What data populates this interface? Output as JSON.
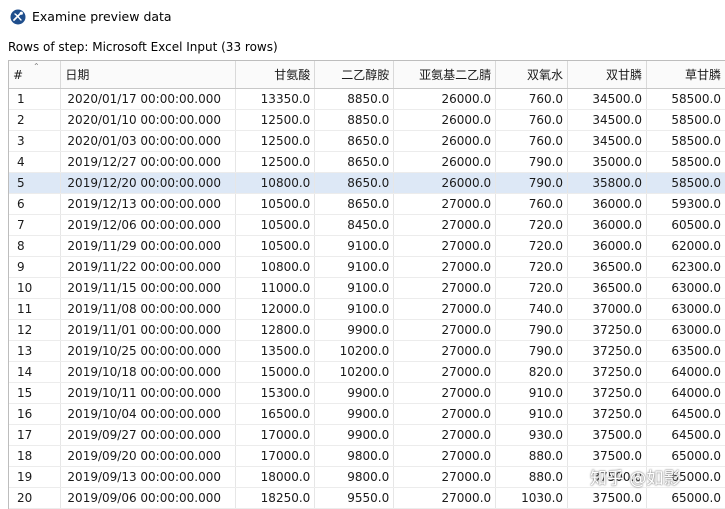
{
  "window": {
    "title": "Examine preview data",
    "icon": "kettle-spoon-icon"
  },
  "subtitle": "Rows of step: Microsoft Excel Input (33 rows)",
  "table": {
    "columns": [
      "#",
      "日期",
      "甘氨酸",
      "二乙醇胺",
      "亚氨基二乙腈",
      "双氧水",
      "双甘膦",
      "草甘膦"
    ],
    "selected_row_index": 4,
    "rows": [
      [
        "1",
        "2020/01/17 00:00:00.000",
        "13350.0",
        "8850.0",
        "26000.0",
        "760.0",
        "34500.0",
        "58500.0"
      ],
      [
        "2",
        "2020/01/10 00:00:00.000",
        "12500.0",
        "8850.0",
        "26000.0",
        "760.0",
        "34500.0",
        "58500.0"
      ],
      [
        "3",
        "2020/01/03 00:00:00.000",
        "12500.0",
        "8650.0",
        "26000.0",
        "760.0",
        "34500.0",
        "58500.0"
      ],
      [
        "4",
        "2019/12/27 00:00:00.000",
        "12500.0",
        "8650.0",
        "26000.0",
        "790.0",
        "35000.0",
        "58500.0"
      ],
      [
        "5",
        "2019/12/20 00:00:00.000",
        "10800.0",
        "8650.0",
        "26000.0",
        "790.0",
        "35800.0",
        "58500.0"
      ],
      [
        "6",
        "2019/12/13 00:00:00.000",
        "10500.0",
        "8650.0",
        "27000.0",
        "760.0",
        "36000.0",
        "59300.0"
      ],
      [
        "7",
        "2019/12/06 00:00:00.000",
        "10500.0",
        "8450.0",
        "27000.0",
        "720.0",
        "36000.0",
        "60500.0"
      ],
      [
        "8",
        "2019/11/29 00:00:00.000",
        "10500.0",
        "9100.0",
        "27000.0",
        "720.0",
        "36000.0",
        "62000.0"
      ],
      [
        "9",
        "2019/11/22 00:00:00.000",
        "10800.0",
        "9100.0",
        "27000.0",
        "720.0",
        "36500.0",
        "62300.0"
      ],
      [
        "10",
        "2019/11/15 00:00:00.000",
        "11000.0",
        "9100.0",
        "27000.0",
        "720.0",
        "36500.0",
        "63000.0"
      ],
      [
        "11",
        "2019/11/08 00:00:00.000",
        "12000.0",
        "9100.0",
        "27000.0",
        "740.0",
        "37000.0",
        "63000.0"
      ],
      [
        "12",
        "2019/11/01 00:00:00.000",
        "12800.0",
        "9900.0",
        "27000.0",
        "790.0",
        "37250.0",
        "63000.0"
      ],
      [
        "13",
        "2019/10/25 00:00:00.000",
        "13500.0",
        "10200.0",
        "27000.0",
        "790.0",
        "37250.0",
        "63500.0"
      ],
      [
        "14",
        "2019/10/18 00:00:00.000",
        "15000.0",
        "10200.0",
        "27000.0",
        "820.0",
        "37250.0",
        "64000.0"
      ],
      [
        "15",
        "2019/10/11 00:00:00.000",
        "15300.0",
        "9900.0",
        "27000.0",
        "910.0",
        "37250.0",
        "64000.0"
      ],
      [
        "16",
        "2019/10/04 00:00:00.000",
        "16500.0",
        "9900.0",
        "27000.0",
        "910.0",
        "37250.0",
        "64500.0"
      ],
      [
        "17",
        "2019/09/27 00:00:00.000",
        "17000.0",
        "9900.0",
        "27000.0",
        "930.0",
        "37500.0",
        "64500.0"
      ],
      [
        "18",
        "2019/09/20 00:00:00.000",
        "17000.0",
        "9800.0",
        "27000.0",
        "880.0",
        "37500.0",
        "65000.0"
      ],
      [
        "19",
        "2019/09/13 00:00:00.000",
        "18000.0",
        "9800.0",
        "27000.0",
        "880.0",
        "37500.0",
        "65000.0"
      ],
      [
        "20",
        "2019/09/06 00:00:00.000",
        "18250.0",
        "9550.0",
        "27000.0",
        "1030.0",
        "37500.0",
        "65000.0"
      ]
    ]
  },
  "watermark": "知乎 @如影",
  "colors": {
    "selected_row": "#dde8f6",
    "grid_line": "#e6e6e6",
    "header_bg": "#fafafa"
  }
}
